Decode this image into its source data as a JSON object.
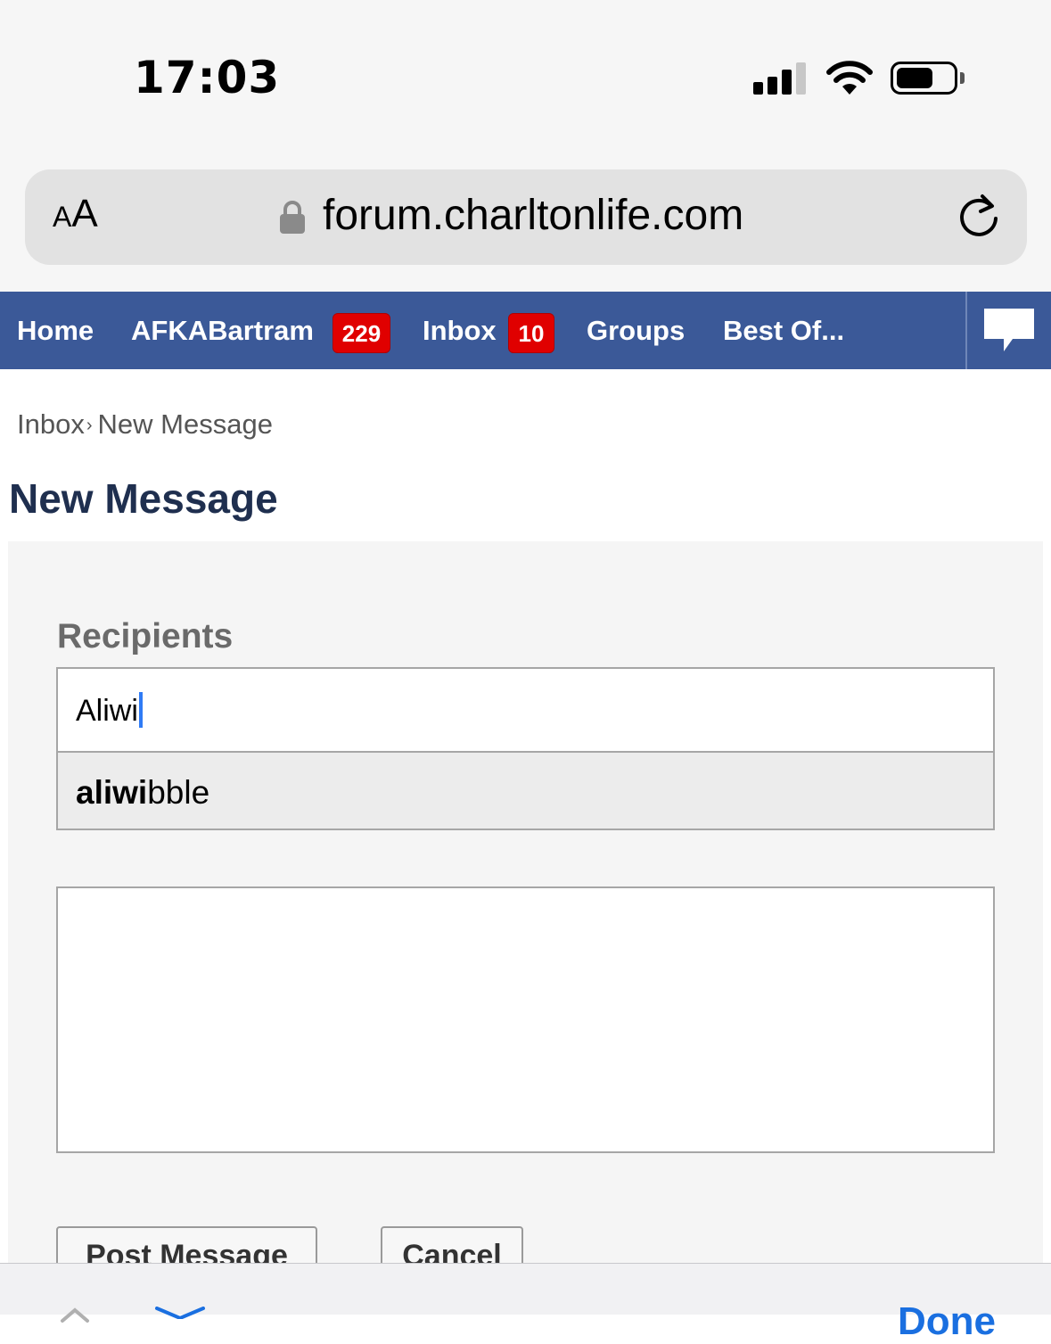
{
  "status_bar": {
    "time": "17:03"
  },
  "browser": {
    "aa_small": "A",
    "aa_large": "A",
    "url": "forum.charltonlife.com"
  },
  "nav": {
    "items": [
      {
        "label": "Home"
      },
      {
        "label": "AFKABartram",
        "badge": "229"
      },
      {
        "label": "Inbox",
        "badge": "10"
      },
      {
        "label": "Groups"
      },
      {
        "label": "Best Of..."
      }
    ]
  },
  "breadcrumb": {
    "parent": "Inbox",
    "separator": "›",
    "current": "New Message"
  },
  "page_title": "New Message",
  "form": {
    "recipients_label": "Recipients",
    "recipients_value": "Aliwi",
    "suggestion_match": "aliwi",
    "suggestion_rest": "bble",
    "message_body": "",
    "post_button": "Post Message",
    "cancel_button": "Cancel"
  },
  "keyboard_accessory": {
    "done_label": "Done"
  },
  "colors": {
    "nav_background": "#3b5998",
    "badge": "#e00000",
    "title": "#1f2f4f",
    "done": "#1a6fe0"
  }
}
